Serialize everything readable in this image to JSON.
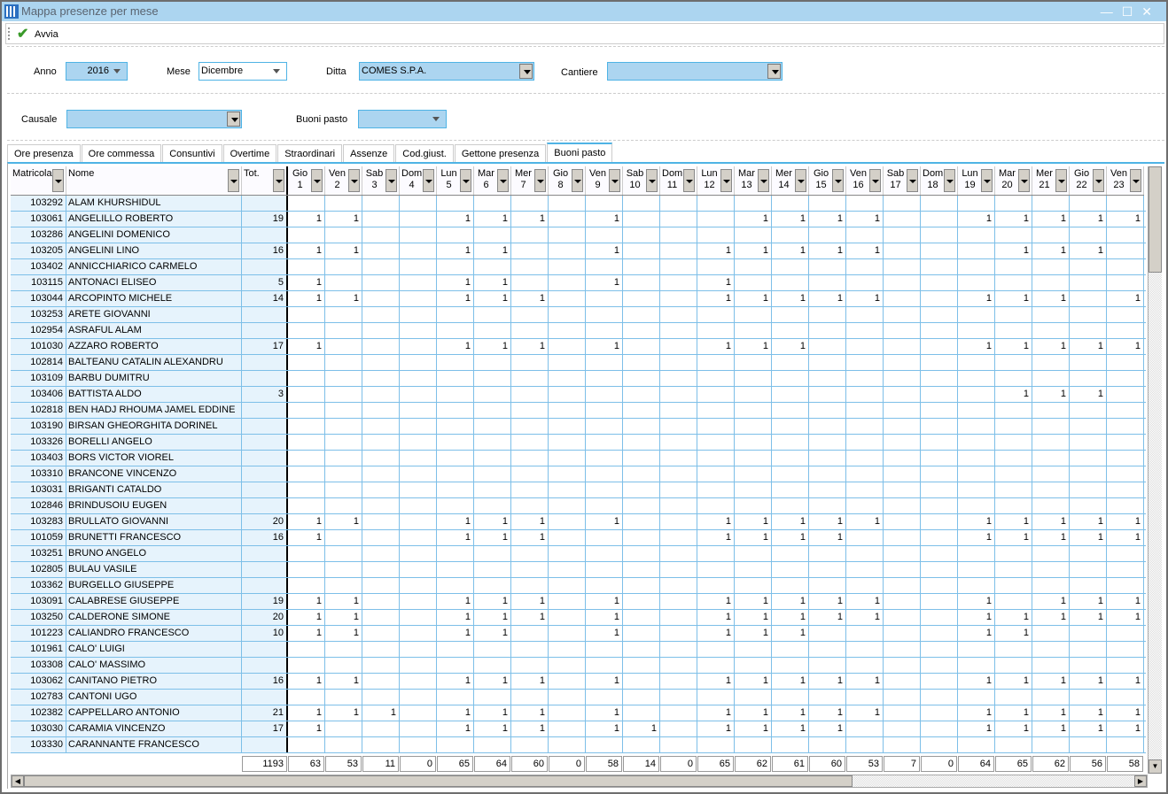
{
  "window": {
    "title": "Mappa presenze per mese",
    "icon": "app-grid-icon",
    "controls": [
      "minimize",
      "maximize",
      "close"
    ]
  },
  "toolbar": {
    "avvia_label": "Avvia",
    "avvia_icon": "checkmark-icon"
  },
  "filters": {
    "anno_label": "Anno",
    "anno_value": "2016",
    "mese_label": "Mese",
    "mese_value": "Dicembre",
    "ditta_label": "Ditta",
    "ditta_value": "COMES S.P.A.",
    "cantiere_label": "Cantiere",
    "cantiere_value": "",
    "causale_label": "Causale",
    "causale_value": "",
    "buoni_label": "Buoni pasto",
    "buoni_value": ""
  },
  "tabs": [
    {
      "label": "Ore presenza"
    },
    {
      "label": "Ore commessa"
    },
    {
      "label": "Consuntivi"
    },
    {
      "label": "Overtime"
    },
    {
      "label": "Straordinari"
    },
    {
      "label": "Assenze"
    },
    {
      "label": "Cod.giust."
    },
    {
      "label": "Gettone presenza"
    },
    {
      "label": "Buoni pasto",
      "active": true
    }
  ],
  "grid": {
    "headers": {
      "matricola": "Matricola",
      "nome": "Nome",
      "tot": "Tot."
    },
    "days": [
      [
        "Gio",
        "1"
      ],
      [
        "Ven",
        "2"
      ],
      [
        "Sab",
        "3"
      ],
      [
        "Dom",
        "4"
      ],
      [
        "Lun",
        "5"
      ],
      [
        "Mar",
        "6"
      ],
      [
        "Mer",
        "7"
      ],
      [
        "Gio",
        "8"
      ],
      [
        "Ven",
        "9"
      ],
      [
        "Sab",
        "10"
      ],
      [
        "Dom",
        "11"
      ],
      [
        "Lun",
        "12"
      ],
      [
        "Mar",
        "13"
      ],
      [
        "Mer",
        "14"
      ],
      [
        "Gio",
        "15"
      ],
      [
        "Ven",
        "16"
      ],
      [
        "Sab",
        "17"
      ],
      [
        "Dom",
        "18"
      ],
      [
        "Lun",
        "19"
      ],
      [
        "Mar",
        "20"
      ],
      [
        "Mer",
        "21"
      ],
      [
        "Gio",
        "22"
      ],
      [
        "Ven",
        "23"
      ]
    ],
    "rows": [
      {
        "matricola": "103292",
        "nome": "ALAM KHURSHIDUL",
        "tot": "",
        "days": []
      },
      {
        "matricola": "103061",
        "nome": "ANGELILLO ROBERTO",
        "tot": "19",
        "days": [
          1,
          2,
          5,
          6,
          7,
          9,
          13,
          14,
          15,
          16,
          19,
          20,
          21,
          22,
          23
        ]
      },
      {
        "matricola": "103286",
        "nome": "ANGELINI DOMENICO",
        "tot": "",
        "days": []
      },
      {
        "matricola": "103205",
        "nome": "ANGELINI LINO",
        "tot": "16",
        "days": [
          1,
          2,
          5,
          6,
          9,
          12,
          13,
          14,
          15,
          16,
          20,
          21,
          22
        ]
      },
      {
        "matricola": "103402",
        "nome": "ANNICCHIARICO CARMELO",
        "tot": "",
        "days": []
      },
      {
        "matricola": "103115",
        "nome": "ANTONACI ELISEO",
        "tot": "5",
        "days": [
          1,
          5,
          6,
          9,
          12
        ]
      },
      {
        "matricola": "103044",
        "nome": "ARCOPINTO MICHELE",
        "tot": "14",
        "days": [
          1,
          2,
          5,
          6,
          7,
          12,
          13,
          14,
          15,
          16,
          19,
          20,
          21,
          23
        ]
      },
      {
        "matricola": "103253",
        "nome": "ARETE GIOVANNI",
        "tot": "",
        "days": []
      },
      {
        "matricola": "102954",
        "nome": "ASRAFUL ALAM",
        "tot": "",
        "days": []
      },
      {
        "matricola": "101030",
        "nome": "AZZARO ROBERTO",
        "tot": "17",
        "days": [
          1,
          5,
          6,
          7,
          9,
          12,
          13,
          14,
          19,
          20,
          21,
          22,
          23
        ]
      },
      {
        "matricola": "102814",
        "nome": "BALTEANU CATALIN ALEXANDRU",
        "tot": "",
        "days": []
      },
      {
        "matricola": "103109",
        "nome": "BARBU DUMITRU",
        "tot": "",
        "days": []
      },
      {
        "matricola": "103406",
        "nome": "BATTISTA ALDO",
        "tot": "3",
        "days": [
          20,
          21,
          22
        ]
      },
      {
        "matricola": "102818",
        "nome": "BEN HADJ RHOUMA JAMEL EDDINE",
        "tot": "",
        "days": []
      },
      {
        "matricola": "103190",
        "nome": "BIRSAN GHEORGHITA DORINEL",
        "tot": "",
        "days": []
      },
      {
        "matricola": "103326",
        "nome": "BORELLI ANGELO",
        "tot": "",
        "days": []
      },
      {
        "matricola": "103403",
        "nome": "BORS VICTOR VIOREL",
        "tot": "",
        "days": []
      },
      {
        "matricola": "103310",
        "nome": "BRANCONE VINCENZO",
        "tot": "",
        "days": []
      },
      {
        "matricola": "103031",
        "nome": "BRIGANTI CATALDO",
        "tot": "",
        "days": []
      },
      {
        "matricola": "102846",
        "nome": "BRINDUSOIU EUGEN",
        "tot": "",
        "days": []
      },
      {
        "matricola": "103283",
        "nome": "BRULLATO GIOVANNI",
        "tot": "20",
        "days": [
          1,
          2,
          5,
          6,
          7,
          9,
          12,
          13,
          14,
          15,
          16,
          19,
          20,
          21,
          22,
          23
        ]
      },
      {
        "matricola": "101059",
        "nome": "BRUNETTI FRANCESCO",
        "tot": "16",
        "days": [
          1,
          5,
          6,
          7,
          12,
          13,
          14,
          15,
          19,
          20,
          21,
          22,
          23
        ]
      },
      {
        "matricola": "103251",
        "nome": "BRUNO ANGELO",
        "tot": "",
        "days": []
      },
      {
        "matricola": "102805",
        "nome": "BULAU VASILE",
        "tot": "",
        "days": []
      },
      {
        "matricola": "103362",
        "nome": "BURGELLO GIUSEPPE",
        "tot": "",
        "days": []
      },
      {
        "matricola": "103091",
        "nome": "CALABRESE GIUSEPPE",
        "tot": "19",
        "days": [
          1,
          2,
          5,
          6,
          7,
          9,
          12,
          13,
          14,
          15,
          16,
          19,
          21,
          22,
          23
        ]
      },
      {
        "matricola": "103250",
        "nome": "CALDERONE SIMONE",
        "tot": "20",
        "days": [
          1,
          2,
          5,
          6,
          7,
          9,
          12,
          13,
          14,
          15,
          16,
          19,
          20,
          21,
          22,
          23
        ]
      },
      {
        "matricola": "101223",
        "nome": "CALIANDRO FRANCESCO",
        "tot": "10",
        "days": [
          1,
          2,
          5,
          6,
          9,
          12,
          13,
          14,
          19,
          20
        ]
      },
      {
        "matricola": "101961",
        "nome": "CALO' LUIGI",
        "tot": "",
        "days": []
      },
      {
        "matricola": "103308",
        "nome": "CALO' MASSIMO",
        "tot": "",
        "days": []
      },
      {
        "matricola": "103062",
        "nome": "CANITANO PIETRO",
        "tot": "16",
        "days": [
          1,
          2,
          5,
          6,
          7,
          9,
          12,
          13,
          14,
          15,
          16,
          19,
          20,
          21,
          22,
          23
        ]
      },
      {
        "matricola": "102783",
        "nome": "CANTONI UGO",
        "tot": "",
        "days": []
      },
      {
        "matricola": "102382",
        "nome": "CAPPELLARO ANTONIO",
        "tot": "21",
        "days": [
          1,
          2,
          3,
          5,
          6,
          7,
          9,
          12,
          13,
          14,
          15,
          16,
          19,
          20,
          21,
          22,
          23
        ]
      },
      {
        "matricola": "103030",
        "nome": "CARAMIA VINCENZO",
        "tot": "17",
        "days": [
          1,
          5,
          6,
          7,
          9,
          10,
          12,
          13,
          14,
          15,
          19,
          20,
          21,
          22,
          23
        ]
      },
      {
        "matricola": "103330",
        "nome": "CARANNANTE FRANCESCO",
        "tot": "",
        "days": []
      }
    ],
    "footer": {
      "tot": "1193",
      "days": [
        "63",
        "53",
        "11",
        "0",
        "65",
        "64",
        "60",
        "0",
        "58",
        "14",
        "0",
        "65",
        "62",
        "61",
        "60",
        "53",
        "7",
        "0",
        "64",
        "65",
        "62",
        "56",
        "58"
      ]
    }
  }
}
